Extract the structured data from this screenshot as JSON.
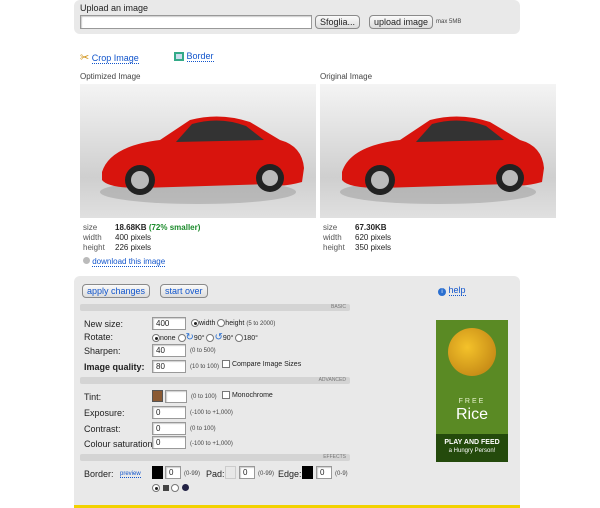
{
  "upload": {
    "title": "Upload an image",
    "browse_label": "Sfoglia...",
    "upload_label": "upload image",
    "max_size": "max 5MB"
  },
  "tools": {
    "crop_label": "Crop Image",
    "border_label": "Border"
  },
  "optimized": {
    "heading": "Optimized Image",
    "size_label": "size",
    "size_value": "18.68KB",
    "size_note": "(72% smaller)",
    "width_label": "width",
    "width_value": "400 pixels",
    "height_label": "height",
    "height_value": "226 pixels",
    "download_label": "download this image"
  },
  "original": {
    "heading": "Original Image",
    "size_label": "size",
    "size_value": "67.30KB",
    "width_label": "width",
    "width_value": "620 pixels",
    "height_label": "height",
    "height_value": "350 pixels"
  },
  "controls": {
    "apply_label": "apply changes",
    "startover_label": "start over",
    "help_label": "help",
    "basic_label": "BASIC",
    "advanced_label": "ADVANCED",
    "effects_label": "EFFECTS",
    "newsize_label": "New size:",
    "newsize_value": "400",
    "width_option": "width",
    "height_option": "height",
    "height_range": "(5 to 2000)",
    "rotate_label": "Rotate:",
    "rotate_none": "none",
    "rotate_90cw": "90°",
    "rotate_90ccw": "90°",
    "rotate_180": "180°",
    "sharpen_label": "Sharpen:",
    "sharpen_value": "40",
    "sharpen_range": "(0 to 500)",
    "quality_label": "Image quality:",
    "quality_value": "80",
    "quality_range": "(10 to 100)",
    "compare_label": "Compare Image Sizes",
    "tint_label": "Tint:",
    "tint_range": "(0 to 100)",
    "tint_color": "#8a5a34",
    "monochrome_label": "Monochrome",
    "exposure_label": "Exposure:",
    "exposure_value": "0",
    "exposure_range": "(-100 to +1,000)",
    "contrast_label": "Contrast:",
    "contrast_value": "0",
    "contrast_range": "(0 to 100)",
    "saturation_label": "Colour saturation:",
    "saturation_value": "0",
    "saturation_range": "(-100 to +1,000)",
    "border_label": "Border:",
    "preview_label": "preview",
    "border_value": "0",
    "border_range": "(0-99)",
    "pad_label": "Pad:",
    "pad_value": "0",
    "pad_range": "(0-99)",
    "edge_label": "Edge:",
    "edge_value": "0",
    "edge_range": "(0-9)"
  },
  "ad": {
    "free": "FREE",
    "rice": "Rice",
    "line1": "PLAY AND FEED",
    "line2": "a Hungry Person!",
    "bg_color": "#5a8a24"
  }
}
